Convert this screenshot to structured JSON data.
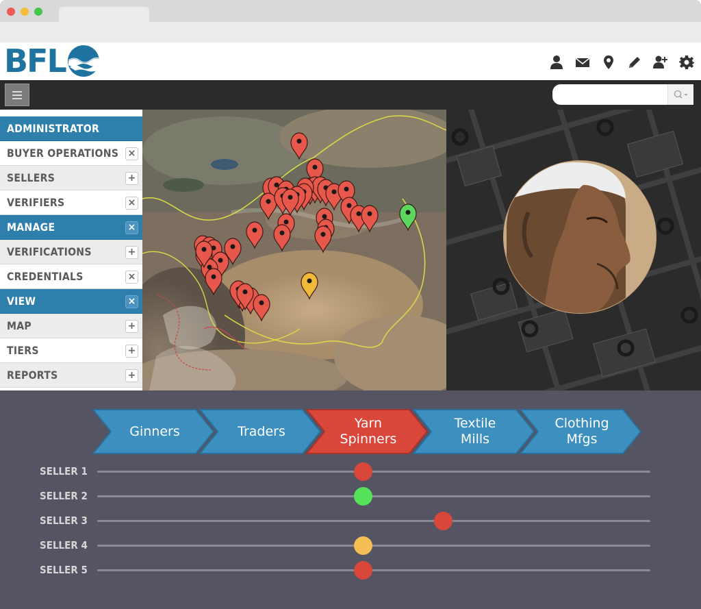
{
  "app": {
    "logo_text": "BFL",
    "header_icons": [
      "user-icon",
      "mail-icon",
      "map-pin-icon",
      "pencil-icon",
      "add-user-icon",
      "gear-icon"
    ]
  },
  "toolbar": {
    "menu_icon": "hamburger-icon",
    "search": {
      "placeholder": "",
      "value": ""
    }
  },
  "sidebar": {
    "sections": [
      {
        "label": "ADMINISTRATOR",
        "type": "header",
        "toggle": ""
      },
      {
        "label": "BUYER OPERATIONS",
        "type": "item",
        "toggle": "×"
      },
      {
        "label": "SELLERS",
        "type": "item",
        "toggle": "+"
      },
      {
        "label": "VERIFIERS",
        "type": "item",
        "toggle": "×"
      },
      {
        "label": "MANAGE",
        "type": "header",
        "toggle": "×"
      },
      {
        "label": "VERIFICATIONS",
        "type": "item",
        "toggle": "+"
      },
      {
        "label": "CREDENTIALS",
        "type": "item",
        "toggle": "×"
      },
      {
        "label": "VIEW",
        "type": "header",
        "toggle": "×"
      },
      {
        "label": "MAP",
        "type": "item",
        "toggle": "+"
      },
      {
        "label": "TIERS",
        "type": "item",
        "toggle": "+"
      },
      {
        "label": "REPORTS",
        "type": "item",
        "toggle": "+"
      }
    ]
  },
  "map": {
    "marker_colors": {
      "red": "#e8574c",
      "green": "#5cd65c",
      "yellow": "#f0b93a"
    },
    "markers": {
      "red": 46,
      "green": 1,
      "yellow": 1
    }
  },
  "tiers": {
    "stages": [
      {
        "label": "Ginners",
        "active": false
      },
      {
        "label": "Traders",
        "active": false
      },
      {
        "label": "Yarn\nSpinners",
        "active": true
      },
      {
        "label": "Textile\nMills",
        "active": false
      },
      {
        "label": "Clothing\nMfgs",
        "active": false
      }
    ],
    "colors": {
      "stage": "#3d8fc0",
      "active": "#d9463a"
    }
  },
  "sellers": [
    {
      "label": "SELLER 1",
      "status": "red",
      "color": "#d9463a",
      "position": 0.48
    },
    {
      "label": "SELLER 2",
      "status": "green",
      "color": "#55e25a",
      "position": 0.48
    },
    {
      "label": "SELLER 3",
      "status": "red",
      "color": "#d9463a",
      "position": 0.625
    },
    {
      "label": "SELLER 4",
      "status": "yellow",
      "color": "#f5be55",
      "position": 0.48
    },
    {
      "label": "SELLER 5",
      "status": "red",
      "color": "#d9463a",
      "position": 0.48
    }
  ]
}
